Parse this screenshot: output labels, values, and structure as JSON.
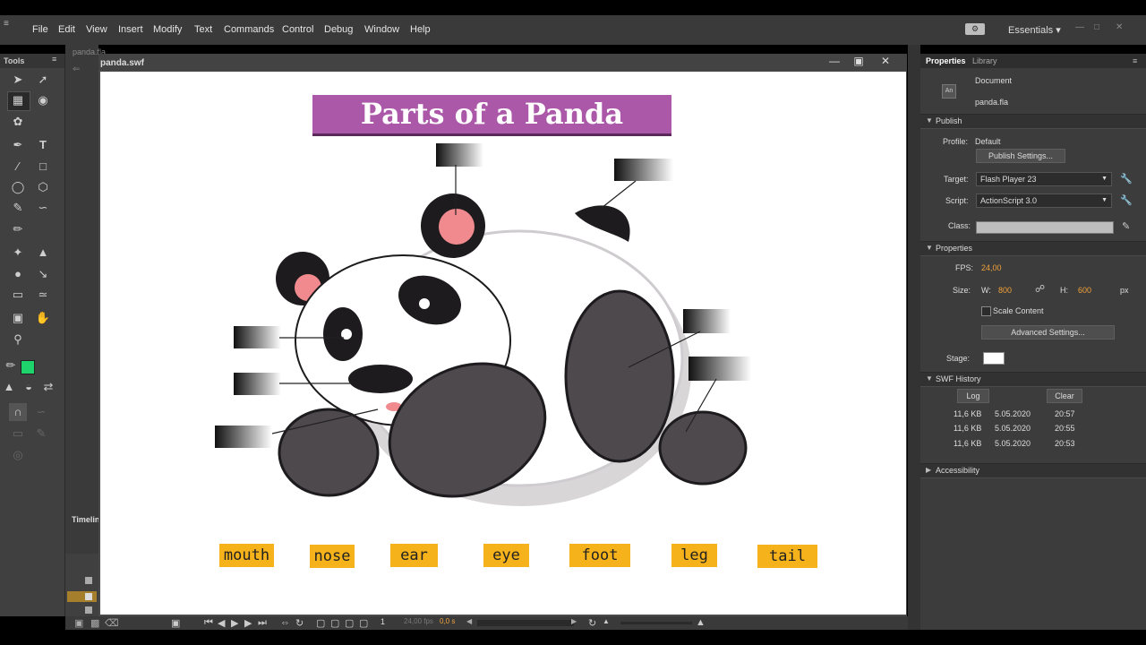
{
  "menubar": {
    "items": [
      "File",
      "Edit",
      "View",
      "Insert",
      "Modify",
      "Text",
      "Commands",
      "Control",
      "Debug",
      "Window",
      "Help"
    ],
    "workspace": "Essentials"
  },
  "tools": {
    "title": "Tools",
    "fill_color": "#1ed36b"
  },
  "doc_tab": "panda.fla",
  "swf_window": {
    "title": "panda.swf"
  },
  "timeline": {
    "label": "Timelin"
  },
  "stage": {
    "title": "Parts of a Panda",
    "title_band_color": "#ab58a8",
    "word_bg": "#f6b21a",
    "words": [
      "mouth",
      "nose",
      "ear",
      "eye",
      "foot",
      "leg",
      "tail"
    ]
  },
  "bottom": {
    "frame": "1",
    "fps": "24,00 fps",
    "time": "0,0 s"
  },
  "properties": {
    "tabs": [
      "Properties",
      "Library"
    ],
    "doc_label": "Document",
    "doc_file": "panda.fla",
    "publish": {
      "section": "Publish",
      "profile_label": "Profile:",
      "profile_value": "Default",
      "settings_button": "Publish Settings...",
      "target_label": "Target:",
      "target_value": "Flash Player 23",
      "script_label": "Script:",
      "script_value": "ActionScript 3.0",
      "class_label": "Class:"
    },
    "props": {
      "section": "Properties",
      "fps_label": "FPS:",
      "fps_value": "24,00",
      "size_label": "Size:",
      "w_label": "W:",
      "w_value": "800",
      "h_label": "H:",
      "h_value": "600",
      "unit": "px",
      "scale_label": "Scale Content",
      "advanced_button": "Advanced Settings...",
      "stage_label": "Stage:",
      "stage_color": "#ffffff"
    },
    "history": {
      "section": "SWF History",
      "log_button": "Log",
      "clear_button": "Clear",
      "rows": [
        {
          "size": "11,6 KB",
          "date": "5.05.2020",
          "time": "20:57"
        },
        {
          "size": "11,6 KB",
          "date": "5.05.2020",
          "time": "20:55"
        },
        {
          "size": "11,6 KB",
          "date": "5.05.2020",
          "time": "20:53"
        }
      ]
    },
    "accessibility": "Accessibility"
  }
}
